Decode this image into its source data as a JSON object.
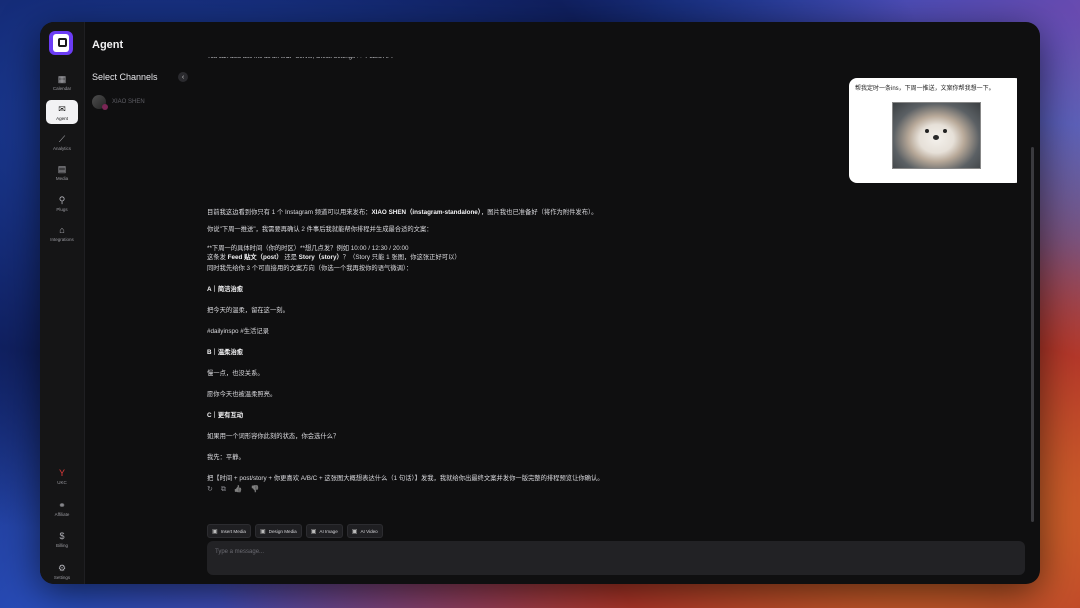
{
  "app": {
    "title": "Agent"
  },
  "nav": {
    "items": [
      {
        "label": "Calendar",
        "icon": "calendar-icon",
        "glyph": "▦"
      },
      {
        "label": "Agent",
        "icon": "chat-bubbles-icon",
        "glyph": "✉"
      },
      {
        "label": "Analytics",
        "icon": "chart-icon",
        "glyph": "⟋"
      },
      {
        "label": "Media",
        "icon": "media-icon",
        "glyph": "▤"
      },
      {
        "label": "Plugs",
        "icon": "plug-icon",
        "glyph": "⚲"
      },
      {
        "label": "Integrations",
        "icon": "integrations-icon",
        "glyph": "⌂"
      },
      {
        "label": "UKC",
        "icon": "ukc-logo-icon",
        "glyph": "Y"
      },
      {
        "label": "Affiliate",
        "icon": "affiliate-icon",
        "glyph": "⚭"
      },
      {
        "label": "Billing",
        "icon": "billing-icon",
        "glyph": "$"
      },
      {
        "label": "Settings",
        "icon": "gear-icon",
        "glyph": "⚙"
      }
    ]
  },
  "channels": {
    "title": "Select Channels",
    "collapse_glyph": "‹",
    "items": [
      {
        "name": "XIAO SHEN"
      }
    ]
  },
  "chat": {
    "top_cut": "You can also use me as an MCP Server, check Settings >> Public API",
    "user_message": "帮我定时一条ins，下周一推送，文案你帮我想一下。",
    "reply": {
      "l1_pre": "目前我这边看到你只有 1 个 Instagram 频道可以用来发布：",
      "l1_bold": "XIAO SHEN（instagram-standalone）",
      "l1_post": "，图片我也已准备好（将作为附件发布）。",
      "l2": "你说\"下周一推送\"，我需要再确认 2 件事后我就能帮你排程并生成最合适的文案：",
      "l3": "**下周一的具体时间（你的时区）**想几点发？例如 10:00 / 12:30 / 20:00",
      "l4_pre": "这条发 ",
      "l4_b1": "Feed 贴文（post）",
      "l4_mid": " 还是 ",
      "l4_b2": "Story（story）",
      "l4_post": "？（Story 只能 1 张图，你这张正好可以）",
      "l5": "同时我先给你 3 个可直接用的文案方向（你选一个我再按你的语气微调）：",
      "a_title": "A｜简洁治愈",
      "a_line": "把今天的温柔，留在这一刻。",
      "a_tags": "#dailyinspo #生活记录",
      "b_title": "B｜温柔治愈",
      "b_line1": "慢一点，也没关系。",
      "b_line2": "愿你今天也被温柔照亮。",
      "c_title": "C｜更有互动",
      "c_line1": "如果用一个词形容你此刻的状态，你会选什么？",
      "c_line2": "我先：平静。",
      "closing": "把【时间 + post/story + 你更喜欢 A/B/C + 这张图大概想表达什么（1 句话）】发我，我就给你出最终文案并发你一版完整的排程预览让你确认。"
    },
    "reply_actions": [
      {
        "icon": "refresh-icon",
        "glyph": "↻"
      },
      {
        "icon": "copy-icon",
        "glyph": "⧉"
      },
      {
        "icon": "thumbs-up-icon",
        "glyph": "👍"
      },
      {
        "icon": "thumbs-down-icon",
        "glyph": "👎"
      }
    ]
  },
  "toolbar": {
    "insert_media": "Insert Media",
    "design_media": "Design Media",
    "ai_image": "AI Image",
    "ai_video": "AI Video"
  },
  "composer": {
    "placeholder": "Type a message..."
  }
}
